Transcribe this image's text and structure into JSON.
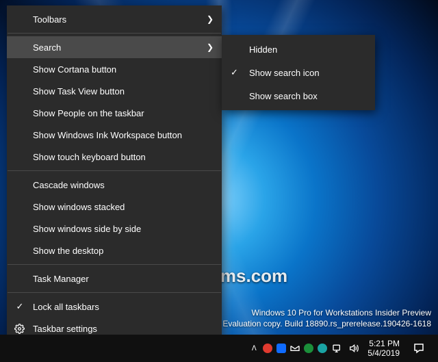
{
  "contextMenu": {
    "items": [
      {
        "label": "Toolbars",
        "hasSubmenu": true
      },
      {
        "label": "Search",
        "hasSubmenu": true,
        "highlighted": true
      },
      {
        "label": "Show Cortana button"
      },
      {
        "label": "Show Task View button"
      },
      {
        "label": "Show People on the taskbar"
      },
      {
        "label": "Show Windows Ink Workspace button"
      },
      {
        "label": "Show touch keyboard button"
      },
      {
        "label": "Cascade windows"
      },
      {
        "label": "Show windows stacked"
      },
      {
        "label": "Show windows side by side"
      },
      {
        "label": "Show the desktop"
      },
      {
        "label": "Task Manager"
      },
      {
        "label": "Lock all taskbars",
        "checked": true
      },
      {
        "label": "Taskbar settings",
        "icon": "gear"
      }
    ]
  },
  "submenu": {
    "items": [
      {
        "label": "Hidden"
      },
      {
        "label": "Show search icon",
        "checked": true
      },
      {
        "label": "Show search box"
      }
    ]
  },
  "editionText": {
    "line1": "Windows 10 Pro for Workstations Insider Preview",
    "line2": "Evaluation copy. Build 18890.rs_prerelease.190426-1618"
  },
  "watermark": "TenForums.com",
  "taskbar": {
    "trayColors": {
      "app1": "#e03a2f",
      "app2": "#0f6bff",
      "app3": "#ffffff",
      "app4": "#1b8f3a",
      "app5": "#1aa3a3"
    },
    "clock": {
      "time": "5:21 PM",
      "date": "5/4/2019"
    }
  }
}
